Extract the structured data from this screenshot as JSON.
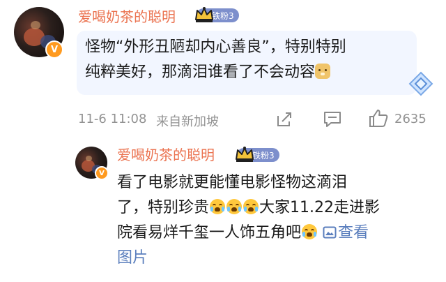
{
  "comment": {
    "username": "爱喝奶茶的聪明",
    "fan_badge": "铁粉3",
    "text_line1": "怪物“外形丑陋却内心善良”，特别特别",
    "text_line2": "纯粹美好，那滴泪谁看了不会动容",
    "date": "11-6 11:08",
    "source": "来自新加坡",
    "like_count": "2635"
  },
  "reply": {
    "username": "爱喝奶茶的聪明",
    "fan_badge": "铁粉3",
    "text_line1": "看了电影就更能懂电影怪物这滴泪",
    "text_line2_a": "了，特别珍贵",
    "text_line2_b": "大家11.22走进影",
    "text_line3": "院看易烊千玺一人饰五角吧",
    "view_image_line3": "查看",
    "view_image_line4": "图片"
  },
  "icons": {
    "verified_badge": "v-badge-icon",
    "crown": "crown-icon",
    "diamond": "diamond-icon",
    "share": "share-icon",
    "comment": "comment-icon",
    "like": "thumbs-up-icon",
    "image": "image-icon",
    "emoji_doge": "doge-emoji-icon",
    "emoji_cry": "crying-emoji-icon"
  },
  "colors": {
    "username": "#eb7350",
    "fan_badge_bg": "#7d8fcc",
    "bubble_bg": "#f2f6ff",
    "meta_text": "#939393",
    "link": "#5a7ebd",
    "verified": "#ff9a1f"
  }
}
